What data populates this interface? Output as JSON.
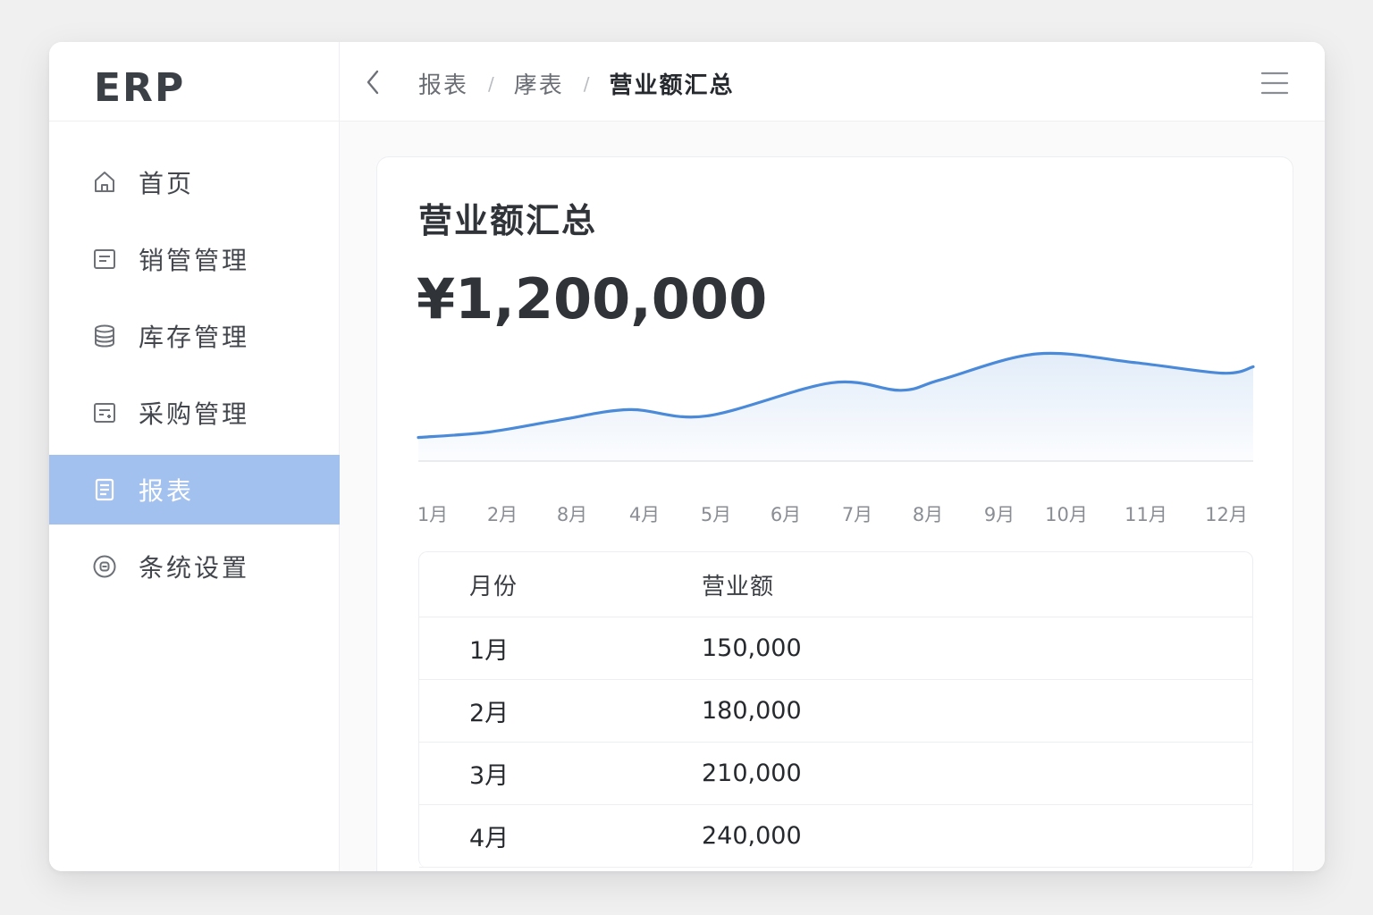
{
  "app": {
    "logo": "ERP"
  },
  "sidebar": {
    "items": [
      {
        "label": "首页",
        "icon": "home-icon",
        "active": false
      },
      {
        "label": "销管管理",
        "icon": "document-icon",
        "active": false
      },
      {
        "label": "库存管理",
        "icon": "database-icon",
        "active": false
      },
      {
        "label": "采购管理",
        "icon": "purchase-form-icon",
        "active": false
      },
      {
        "label": "报表",
        "icon": "report-icon",
        "active": true
      },
      {
        "label": "条统设置",
        "icon": "settings-icon",
        "active": false
      }
    ]
  },
  "header": {
    "breadcrumb": [
      "报表",
      "庨表",
      "营业额汇总"
    ],
    "separator": "/"
  },
  "card": {
    "title": "营业额汇总",
    "total": "¥1,200,000"
  },
  "chart_data": {
    "type": "area",
    "categories": [
      "1月",
      "2月",
      "8月",
      "4月",
      "5月",
      "6月",
      "7月",
      "8月",
      "9月",
      "10月",
      "11月",
      "12月"
    ],
    "values": [
      0.22,
      0.27,
      0.38,
      0.48,
      0.42,
      0.73,
      0.66,
      0.76,
      1.0,
      0.92,
      0.82,
      0.88
    ],
    "y_unit": "relative height, axis has no printed ticks",
    "grid": false,
    "color": "#4a8ad8"
  },
  "table": {
    "headers": {
      "month": "月份",
      "amount": "营业额"
    },
    "rows": [
      {
        "month": "1月",
        "amount": "150,000"
      },
      {
        "month": "2月",
        "amount": "180,000"
      },
      {
        "month": "3月",
        "amount": "210,000"
      },
      {
        "month": "4月",
        "amount": "240,000"
      }
    ]
  }
}
